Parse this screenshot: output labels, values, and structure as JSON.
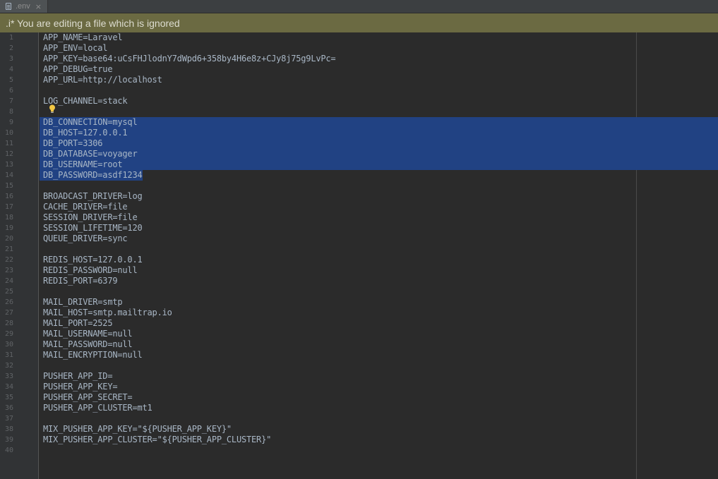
{
  "tab": {
    "label": ".env",
    "icon": "file-icon",
    "close_glyph": "×"
  },
  "notice": {
    "text": ".i* You are editing a file which is ignored"
  },
  "editor": {
    "selection_color": "#214283",
    "text_color": "#a9b7c6",
    "lines": [
      {
        "n": "1",
        "text": "APP_NAME=Laravel"
      },
      {
        "n": "2",
        "text": "APP_ENV=local"
      },
      {
        "n": "3",
        "text": "APP_KEY=base64:uCsFHJlodnY7dWpd6+358by4H6e8z+CJy8j75g9LvPc="
      },
      {
        "n": "4",
        "text": "APP_DEBUG=true"
      },
      {
        "n": "5",
        "text": "APP_URL=http://localhost"
      },
      {
        "n": "6",
        "text": ""
      },
      {
        "n": "7",
        "text": "LOG_CHANNEL=stack"
      },
      {
        "n": "8",
        "text": ""
      },
      {
        "n": "9",
        "text": "DB_CONNECTION=mysql"
      },
      {
        "n": "10",
        "text": "DB_HOST=127.0.0.1"
      },
      {
        "n": "11",
        "text": "DB_PORT=3306"
      },
      {
        "n": "12",
        "text": "DB_DATABASE=voyager"
      },
      {
        "n": "13",
        "text": "DB_USERNAME=root"
      },
      {
        "n": "14",
        "text": "DB_PASSWORD=asdf1234"
      },
      {
        "n": "15",
        "text": ""
      },
      {
        "n": "16",
        "text": "BROADCAST_DRIVER=log"
      },
      {
        "n": "17",
        "text": "CACHE_DRIVER=file"
      },
      {
        "n": "18",
        "text": "SESSION_DRIVER=file"
      },
      {
        "n": "19",
        "text": "SESSION_LIFETIME=120"
      },
      {
        "n": "20",
        "text": "QUEUE_DRIVER=sync"
      },
      {
        "n": "21",
        "text": ""
      },
      {
        "n": "22",
        "text": "REDIS_HOST=127.0.0.1"
      },
      {
        "n": "23",
        "text": "REDIS_PASSWORD=null"
      },
      {
        "n": "24",
        "text": "REDIS_PORT=6379"
      },
      {
        "n": "25",
        "text": ""
      },
      {
        "n": "26",
        "text": "MAIL_DRIVER=smtp"
      },
      {
        "n": "27",
        "text": "MAIL_HOST=smtp.mailtrap.io"
      },
      {
        "n": "28",
        "text": "MAIL_PORT=2525"
      },
      {
        "n": "29",
        "text": "MAIL_USERNAME=null"
      },
      {
        "n": "30",
        "text": "MAIL_PASSWORD=null"
      },
      {
        "n": "31",
        "text": "MAIL_ENCRYPTION=null"
      },
      {
        "n": "32",
        "text": ""
      },
      {
        "n": "33",
        "text": "PUSHER_APP_ID="
      },
      {
        "n": "34",
        "text": "PUSHER_APP_KEY="
      },
      {
        "n": "35",
        "text": "PUSHER_APP_SECRET="
      },
      {
        "n": "36",
        "text": "PUSHER_APP_CLUSTER=mt1"
      },
      {
        "n": "37",
        "text": ""
      },
      {
        "n": "38",
        "text": "MIX_PUSHER_APP_KEY=\"${PUSHER_APP_KEY}\""
      },
      {
        "n": "39",
        "text": "MIX_PUSHER_APP_CLUSTER=\"${PUSHER_APP_CLUSTER}\""
      },
      {
        "n": "40",
        "text": ""
      }
    ],
    "selected_lines": [
      "9",
      "10",
      "11",
      "12",
      "13",
      "14"
    ],
    "intention_icon": "lightbulb-icon"
  }
}
